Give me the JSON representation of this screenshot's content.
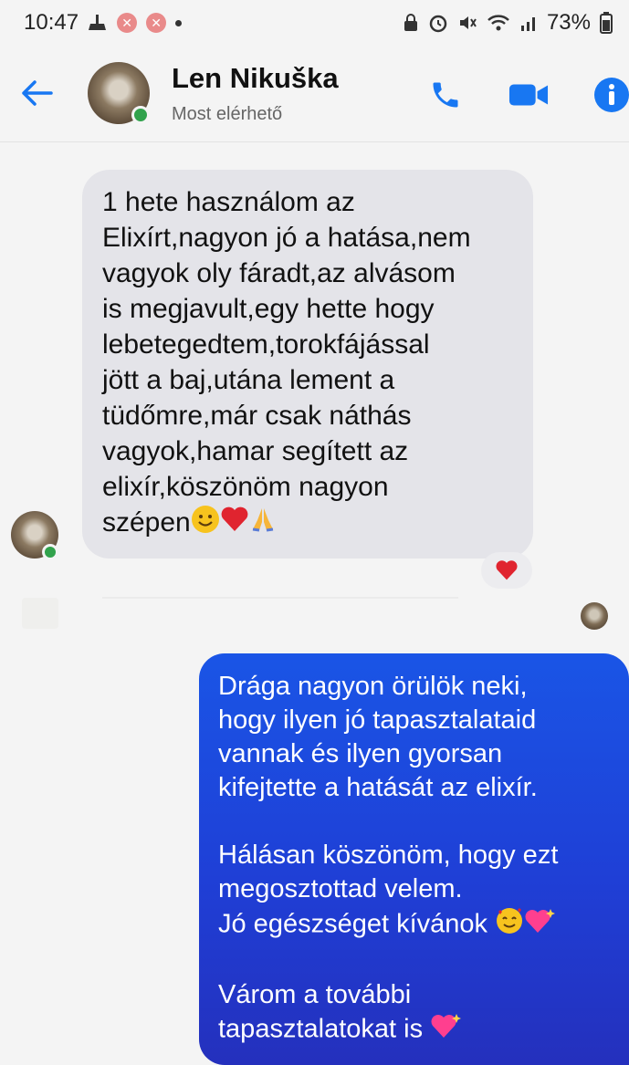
{
  "status_bar": {
    "time": "10:47",
    "battery": "73%"
  },
  "header": {
    "contact_name": "Len Nikuška",
    "contact_status": "Most elérhető"
  },
  "messages": {
    "incoming": {
      "text": "1 hete használom az\nElixírt,nagyon jó a hatása,nem\nvagyok oly fáradt,az alvásom\nis megjavult,egy hette hogy\nlebetegedtem,torokfájással\njött a baj,utána lement a\ntüdőmre,már csak náthás\nvagyok,hamar segített az\nelixír,köszönöm nagyon\nszépen",
      "reaction": "heart"
    },
    "outgoing": {
      "p1": "Drága nagyon örülök neki,\nhogy ilyen jó tapasztalataid\nvannak és ilyen gyorsan\nkifejtette a hatását az elixír.",
      "p2": "Hálásan köszönöm, hogy ezt\nmegosztottad velem.\nJó egészséget kívánok",
      "p3": "Várom a további\ntapasztalatokat is"
    }
  },
  "colors": {
    "accent": "#1877f2",
    "outgoing_bubble": "#1f3fd6",
    "incoming_bubble": "#e4e4e9",
    "online": "#31a24c",
    "heart": "#e0242f"
  }
}
